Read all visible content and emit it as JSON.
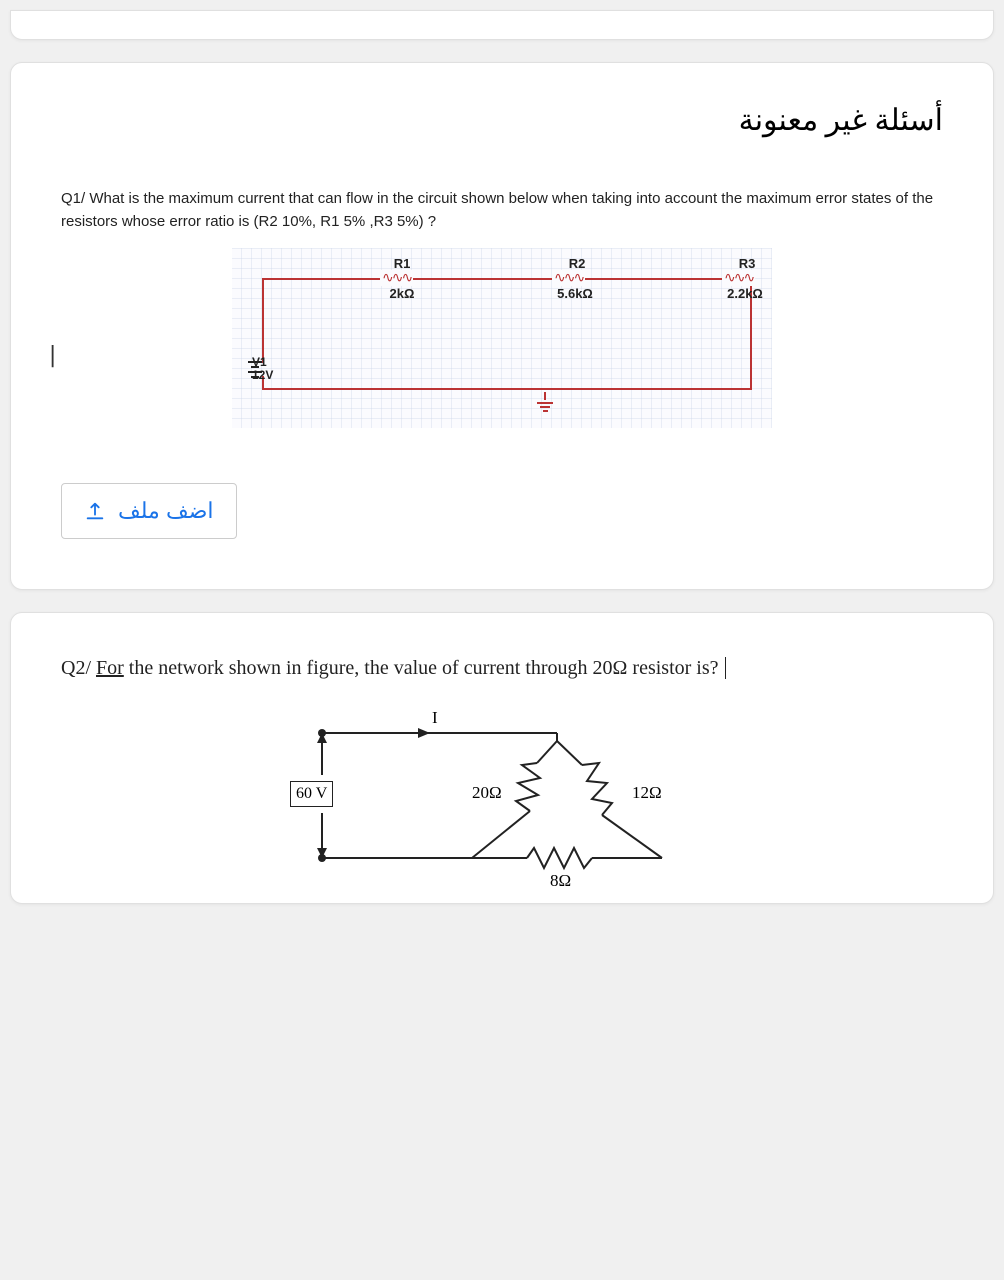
{
  "section_title": "أسئلة غير معنونة",
  "q1": {
    "text": "Q1/ What is the maximum current that can flow in the circuit shown below when taking into account the maximum error states of the resistors whose error ratio is (R2 10%, R1 5% ,R3 5%) ?",
    "circuit": {
      "R1": {
        "name": "R1",
        "value": "2kΩ"
      },
      "R2": {
        "name": "R2",
        "value": "5.6kΩ"
      },
      "R3": {
        "name": "R3",
        "value": "2.2kΩ"
      },
      "V1": {
        "name": "V1",
        "value": "12V"
      }
    }
  },
  "cursor_mark": "|",
  "upload_label": "اضف ملف",
  "q2": {
    "prefix": "Q2/ ",
    "for_word": "For",
    "rest": " the network shown in figure, the value of current through 20Ω resistor is?",
    "circuit": {
      "I": "I",
      "V": "60 V",
      "R20": "20Ω",
      "R12": "12Ω",
      "R8": "8Ω"
    }
  }
}
